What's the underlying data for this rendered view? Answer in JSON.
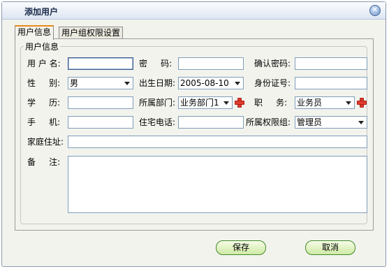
{
  "window": {
    "title": "添加用户",
    "close_glyph": "✕"
  },
  "tabs": [
    {
      "label": "用户信息"
    },
    {
      "label": "用户组权限设置"
    }
  ],
  "group": {
    "legend": "用户信息"
  },
  "form": {
    "username": {
      "label": "用 户 名:",
      "value": ""
    },
    "password": {
      "label": "密    码:",
      "value": ""
    },
    "confirm_password": {
      "label": "确认密码:",
      "value": ""
    },
    "gender": {
      "label": "性    别:",
      "value": "男"
    },
    "birthdate": {
      "label": "出生日期:",
      "value": "2005-08-10"
    },
    "id_number": {
      "label": "身份证号:",
      "value": ""
    },
    "education": {
      "label": "学    历:",
      "value": ""
    },
    "department": {
      "label": "所属部门:",
      "value": "业务部门1"
    },
    "position": {
      "label": "职    务:",
      "value": "业务员"
    },
    "mobile": {
      "label": "手    机:",
      "value": ""
    },
    "home_phone": {
      "label": "住宅电话:",
      "value": ""
    },
    "permission_group": {
      "label": "所属权限组:",
      "value": "管理员"
    },
    "address": {
      "label": "家庭住址:",
      "value": ""
    },
    "remark": {
      "label": "备    注:",
      "value": ""
    }
  },
  "buttons": {
    "save": "保存",
    "cancel": "取消"
  },
  "icons": {
    "add": "plus-icon",
    "close": "close-icon",
    "dropdown": "chevron-down-icon"
  },
  "colors": {
    "accent": "#e88a16",
    "button_border": "#3f8a2a",
    "add_icon": "#e23b2e"
  }
}
